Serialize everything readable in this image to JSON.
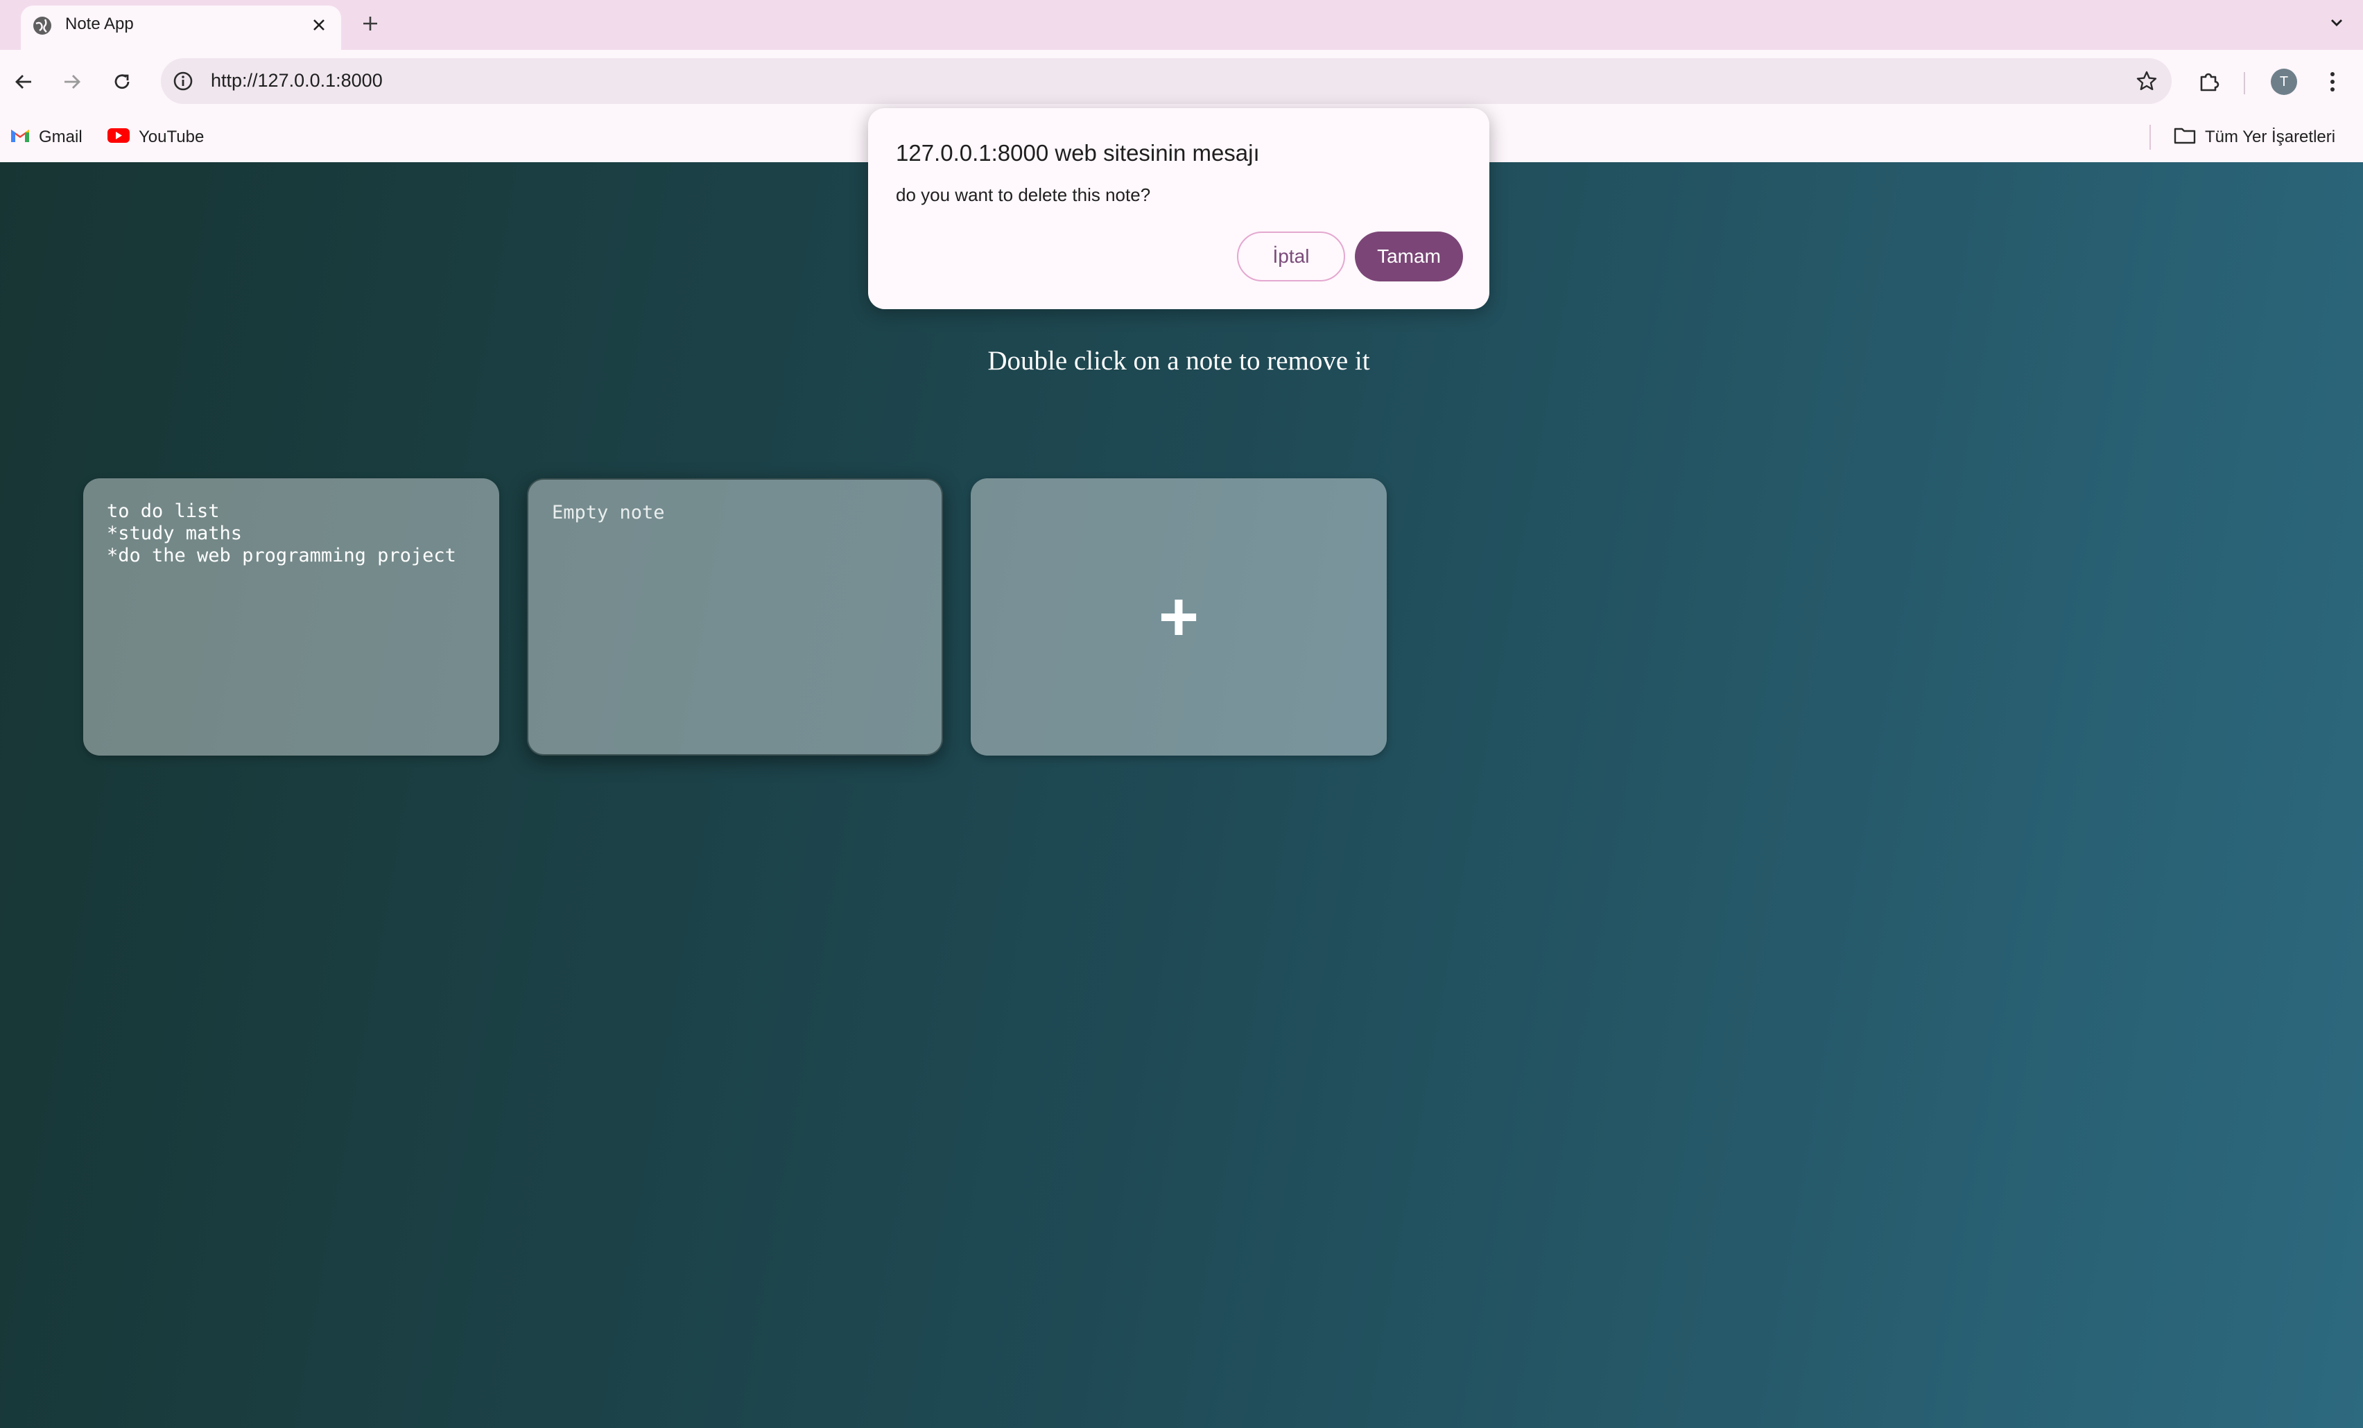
{
  "browser": {
    "tab": {
      "title": "Note App"
    },
    "address_bar": {
      "url": "http://127.0.0.1:8000"
    },
    "profile_initial": "T",
    "bookmarks": [
      {
        "label": "Gmail"
      },
      {
        "label": "YouTube"
      }
    ],
    "all_bookmarks_label": "Tüm Yer İşaretleri"
  },
  "page": {
    "hint": "Double click on a note to remove it",
    "notes": [
      {
        "content": "to do list\n*study maths\n*do the web programming project",
        "placeholder": "Empty note"
      },
      {
        "content": "",
        "placeholder": "Empty note"
      }
    ],
    "add_button": "+"
  },
  "dialog": {
    "title": "127.0.0.1:8000 web sitesinin mesajı",
    "message": "do you want to delete this note?",
    "cancel_label": "İptal",
    "ok_label": "Tamam"
  },
  "colors": {
    "dialog_ok": "#7b4677",
    "tab_strip": "#f2dcec",
    "page_gradient_start": "#173533",
    "page_gradient_end": "#2d697f"
  }
}
